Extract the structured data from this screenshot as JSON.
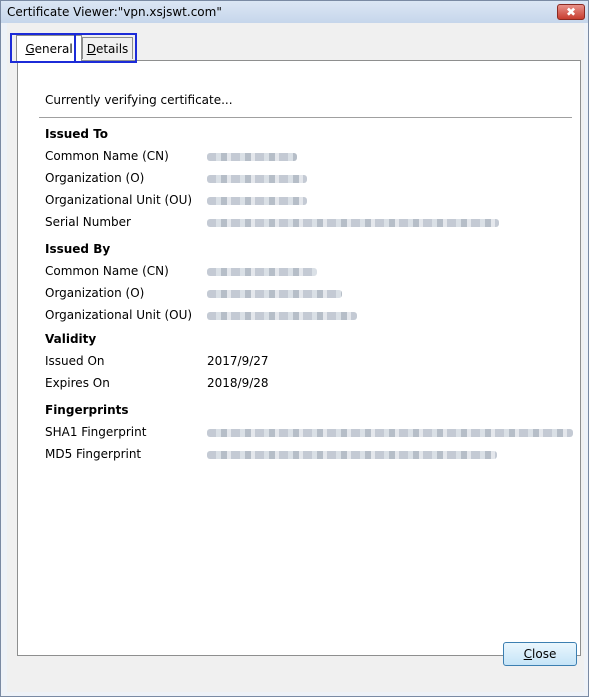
{
  "window": {
    "title": "Certificate Viewer:\"vpn.xsjswt.com\"",
    "close_glyph": "✖"
  },
  "tabs": [
    {
      "label_prefix": "G",
      "label_rest": "eneral",
      "selected": true
    },
    {
      "label_prefix": "D",
      "label_rest": "etails",
      "selected": false
    }
  ],
  "status": "Currently verifying certificate...",
  "issued_to": {
    "heading": "Issued To",
    "rows": [
      {
        "label": "Common Name (CN)",
        "value_redacted": true
      },
      {
        "label": "Organization (O)",
        "value_redacted": true
      },
      {
        "label": "Organizational Unit (OU)",
        "value_redacted": true
      },
      {
        "label": "Serial Number",
        "value_redacted": true
      }
    ]
  },
  "issued_by": {
    "heading": "Issued By",
    "rows": [
      {
        "label": "Common Name (CN)",
        "value_redacted": true
      },
      {
        "label": "Organization (O)",
        "value_redacted": true
      },
      {
        "label": "Organizational Unit (OU)",
        "value_redacted": true
      }
    ]
  },
  "validity": {
    "heading": "Validity",
    "issued_on_label": "Issued On",
    "issued_on_value": "2017/9/27",
    "expires_on_label": "Expires On",
    "expires_on_value": "2018/9/28"
  },
  "fingerprints": {
    "heading": "Fingerprints",
    "sha1_label": "SHA1 Fingerprint",
    "md5_label": "MD5 Fingerprint",
    "values_redacted": true
  },
  "buttons": {
    "close_prefix": "C",
    "close_rest": "lose"
  },
  "colors": {
    "highlight_box": "#1c2bd8",
    "title_close": "#c73d2f"
  }
}
